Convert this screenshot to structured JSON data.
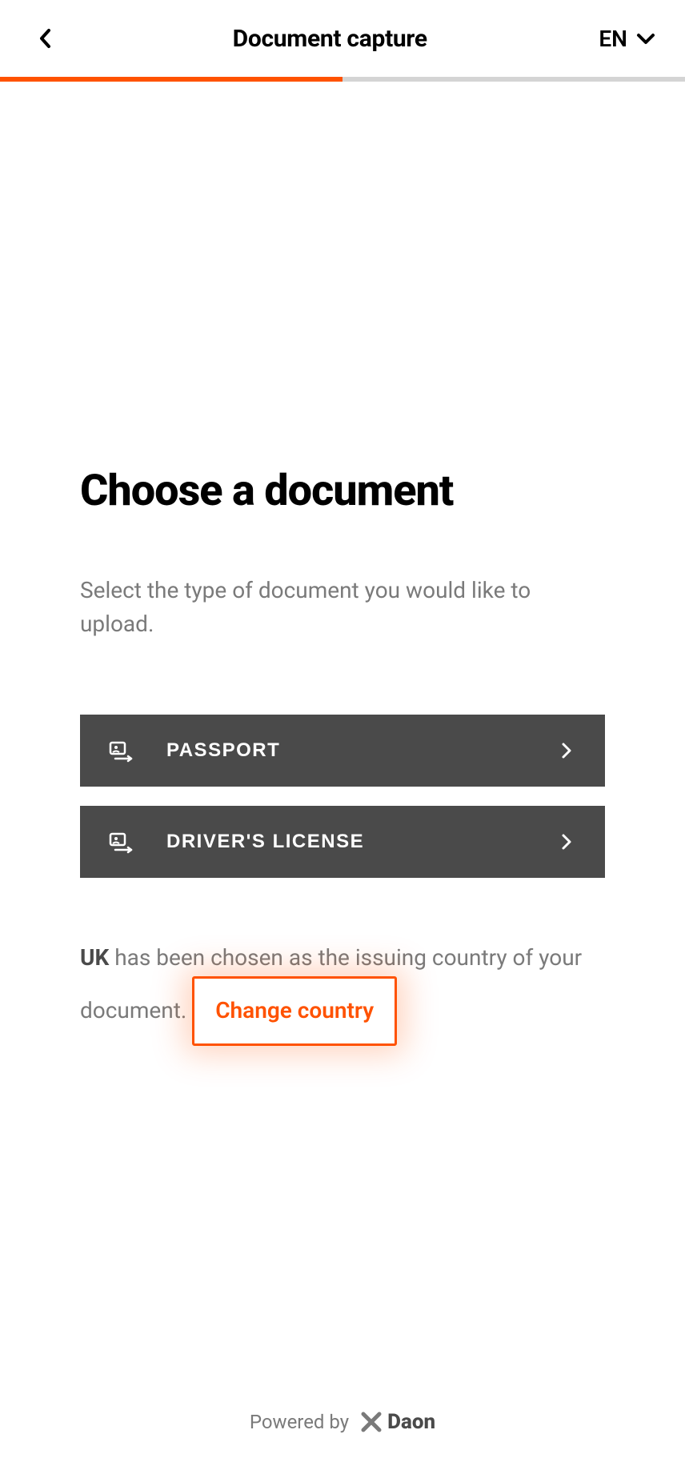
{
  "header": {
    "title": "Document capture",
    "language": "EN"
  },
  "progress": {
    "percent": 50
  },
  "main": {
    "heading": "Choose a document",
    "description": "Select the type of document you would like to upload.",
    "documents": [
      {
        "label": "PASSPORT"
      },
      {
        "label": "DRIVER'S LICENSE"
      }
    ],
    "country": {
      "code": "UK",
      "text_prefix": " has been chosen as the issuing country of your document. ",
      "change_link": "Change country"
    }
  },
  "footer": {
    "powered_by": "Powered by",
    "brand": "Daon"
  }
}
